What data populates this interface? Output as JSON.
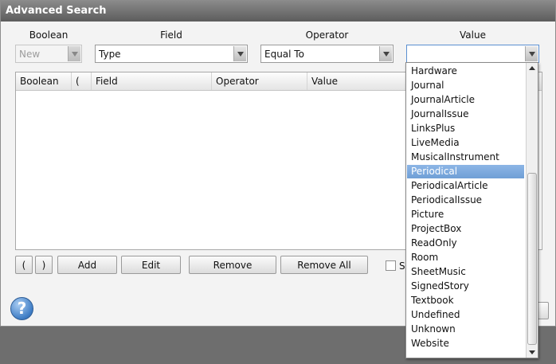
{
  "dialog": {
    "title": "Advanced Search"
  },
  "columns": {
    "boolean_label": "Boolean",
    "field_label": "Field",
    "operator_label": "Operator",
    "value_label": "Value"
  },
  "inputs": {
    "boolean_value": "New",
    "field_value": "Type",
    "operator_value": "Equal To",
    "value_value": ""
  },
  "grid": {
    "headers": [
      "Boolean",
      "(",
      "Field",
      "Operator",
      "Value"
    ]
  },
  "buttons": {
    "open_paren": "(",
    "close_paren": ")",
    "add": "Add",
    "edit": "Edit",
    "remove": "Remove",
    "remove_all": "Remove All",
    "checkbox_label": "S"
  },
  "help": {
    "glyph": "?"
  },
  "dropdown": {
    "items": [
      "Hardware",
      "Journal",
      "JournalArticle",
      "JournalIssue",
      "LinksPlus",
      "LiveMedia",
      "MusicalInstrument",
      "Periodical",
      "PeriodicalArticle",
      "PeriodicalIssue",
      "Picture",
      "ProjectBox",
      "ReadOnly",
      "Room",
      "SheetMusic",
      "SignedStory",
      "Textbook",
      "Undefined",
      "Unknown",
      "Website"
    ],
    "selected": "Periodical"
  },
  "colors": {
    "selection": "#7aa7dc",
    "titlebar": "#6b6b6b"
  }
}
